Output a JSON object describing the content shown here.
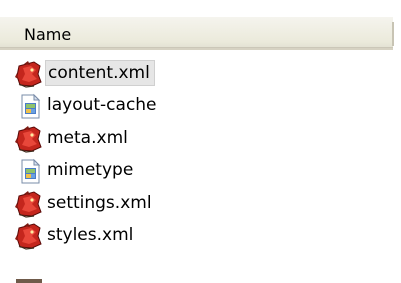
{
  "list": {
    "column_header": "Name",
    "files": [
      {
        "name": "content.xml",
        "icon": "xml-file-icon",
        "selected": true
      },
      {
        "name": "layout-cache",
        "icon": "generic-file-icon",
        "selected": false
      },
      {
        "name": "meta.xml",
        "icon": "xml-file-icon",
        "selected": false
      },
      {
        "name": "mimetype",
        "icon": "generic-file-icon",
        "selected": false
      },
      {
        "name": "settings.xml",
        "icon": "xml-file-icon",
        "selected": false
      },
      {
        "name": "styles.xml",
        "icon": "xml-file-icon",
        "selected": false
      }
    ]
  },
  "colors": {
    "header_bg": "#ebeadb",
    "selection_bg": "#e6e6e6",
    "xml_icon_red": "#c4261d"
  }
}
